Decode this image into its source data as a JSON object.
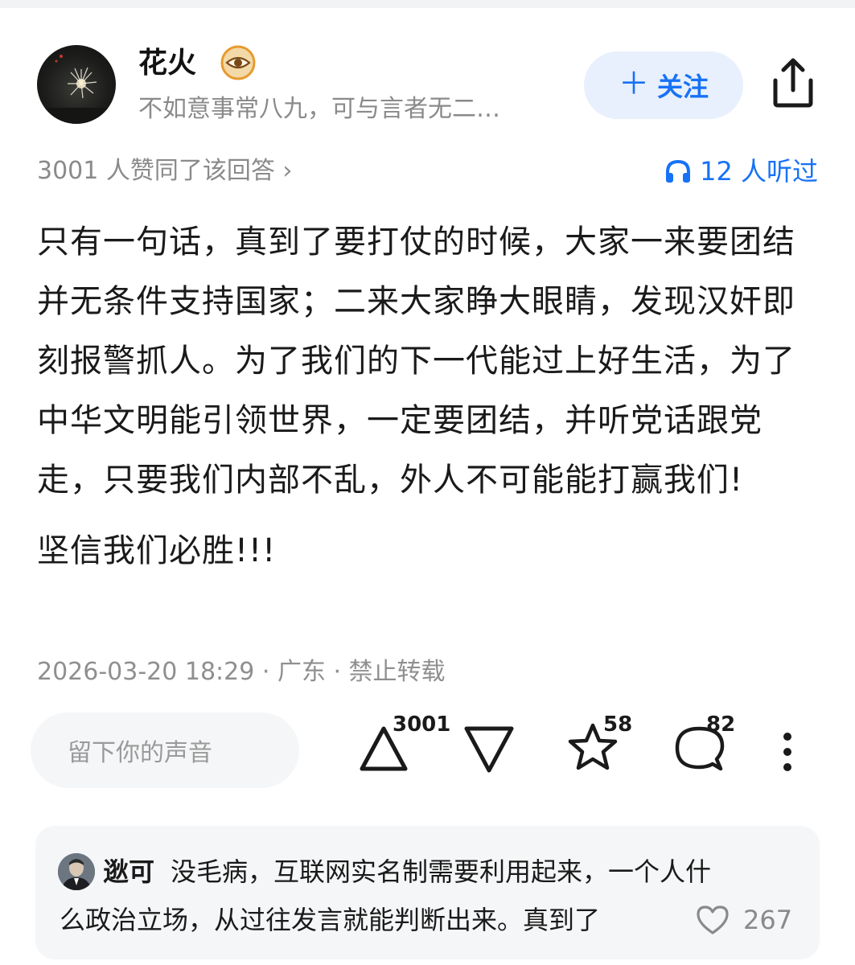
{
  "author": {
    "name": "花火",
    "signature": "不如意事常八九，可与言者无二…"
  },
  "follow_button": {
    "icon": "plus-icon",
    "label": "关注"
  },
  "share_button": {
    "icon": "share-icon"
  },
  "upvote_summary": "3001 人赞同了该回答 ›",
  "listen": {
    "icon": "headphones-icon",
    "label": "12 人听过"
  },
  "answer": {
    "paragraphs": [
      "只有一句话，真到了要打仗的时候，大家一来要团结并无条件支持国家；二来大家睁大眼睛，发现汉奸即刻报警抓人。为了我们的下一代能过上好生活，为了中华文明能引领世界，一定要团结，并听党话跟党走，只要我们内部不乱，外人不可能能打赢我们!",
      "坚信我们必胜!!!"
    ]
  },
  "post_meta": "2026-03-20 18:29 · 广东 · 禁止转载",
  "action_bar": {
    "comment_placeholder": "留下你的声音",
    "upvote_count": "3001",
    "favorite_count": "58",
    "comment_count": "82"
  },
  "featured_comment": {
    "author": "逖可",
    "line1": "没毛病，互联网实名制需要利用起来，一个人什",
    "line2": "么政治立场，从过往发言就能判断出来。真到了",
    "like_count": "267"
  },
  "colors": {
    "accent": "#1772f6",
    "follow_bg": "#e8f0fd",
    "muted_text": "#8a8a8a",
    "badge_orange": "#f0a020"
  }
}
